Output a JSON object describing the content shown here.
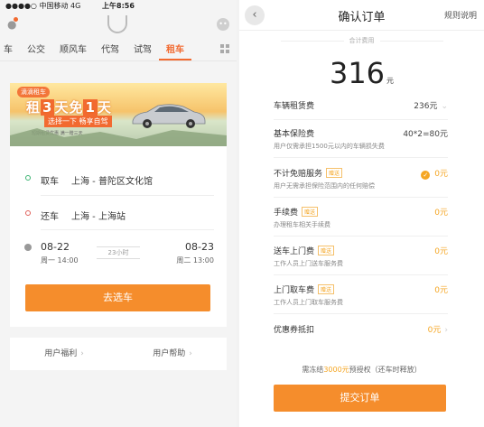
{
  "left": {
    "status": {
      "carrier": "●●●●○ 中国移动  4G",
      "time": "上午8:56",
      "right": "@ ↗ ✱"
    },
    "tabs": [
      "车",
      "公交",
      "顺风车",
      "代驾",
      "试驾",
      "租车"
    ],
    "active_tab": "租车",
    "banner": {
      "brand": "滴滴租车",
      "headline_a": "租",
      "headline_b": "3",
      "headline_c": "天免",
      "headline_d": "1",
      "headline_e": "天",
      "sub": "选择一下  畅享自驾",
      "small": "短期租赁优惠  满一赠三天"
    },
    "pickup": {
      "label": "取车",
      "value": "上海 - 普陀区文化馆"
    },
    "dropoff": {
      "label": "还车",
      "value": "上海 - 上海站"
    },
    "dates": {
      "start_date": "08-22",
      "start_time": "周一 14:00",
      "duration": "23小时",
      "end_date": "08-23",
      "end_time": "周二 13:00"
    },
    "go_button": "去选车",
    "footer": {
      "welfare": "用户福利",
      "help": "用户帮助"
    }
  },
  "right": {
    "title": "确认订单",
    "rule": "规则说明",
    "total_label": "合计费用",
    "total": "316",
    "total_unit": "元",
    "fees": [
      {
        "name": "车辆租赁费",
        "tag": "",
        "desc": "",
        "price": "236元",
        "orange": false,
        "chevron": true,
        "checked": false
      },
      {
        "name": "基本保险费",
        "tag": "",
        "desc": "用户仅需承担1500元以内的车辆损失费",
        "price": "40*2=80元",
        "orange": false,
        "chevron": false,
        "checked": false
      },
      {
        "name": "不计免赔服务",
        "tag": "赠送",
        "desc": "用户无需承担保险范围内的任何赔偿",
        "price": "0元",
        "orange": true,
        "chevron": false,
        "checked": true
      },
      {
        "name": "手续费",
        "tag": "赠送",
        "desc": "办理租车相关手续费",
        "price": "0元",
        "orange": true,
        "chevron": false,
        "checked": false
      },
      {
        "name": "送车上门费",
        "tag": "赠送",
        "desc": "工作人员上门送车服务费",
        "price": "0元",
        "orange": true,
        "chevron": false,
        "checked": false
      },
      {
        "name": "上门取车费",
        "tag": "赠送",
        "desc": "工作人员上门取车服务费",
        "price": "0元",
        "orange": true,
        "chevron": false,
        "checked": false
      },
      {
        "name": "优惠券抵扣",
        "tag": "",
        "desc": "",
        "price": "0元",
        "orange": true,
        "chevron": true,
        "checked": false
      }
    ],
    "deposit_pre": "需冻结",
    "deposit_amount": "3000元",
    "deposit_post": "预授权（还车时释放）",
    "submit_button": "提交订单"
  },
  "colors": {
    "accent": "#f58d2c",
    "orange_text": "#f5a623"
  },
  "icons": [
    "user-icon",
    "didi-logo-icon",
    "message-icon",
    "grid-icon",
    "back-icon",
    "check-icon",
    "chevron-right-icon",
    "clock-icon"
  ]
}
